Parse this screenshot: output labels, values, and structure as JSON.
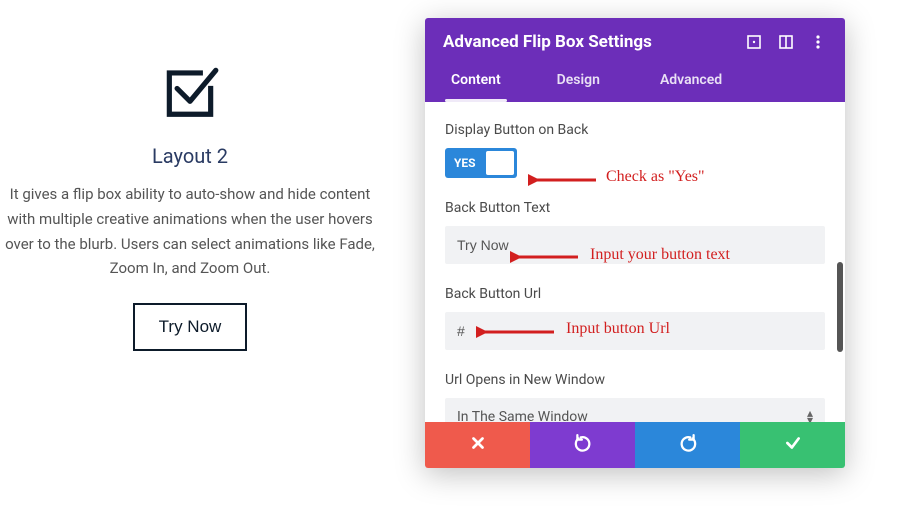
{
  "preview": {
    "title": "Layout 2",
    "desc": "It gives a flip box ability to auto-show and hide content with multiple creative animations when the user hovers over to the blurb. Users can select animations like Fade, Zoom In, and Zoom Out.",
    "button": "Try Now"
  },
  "panel": {
    "title": "Advanced Flip Box Settings",
    "tabs": {
      "content": "Content",
      "design": "Design",
      "advanced": "Advanced"
    },
    "fields": {
      "display_button_label": "Display Button on Back",
      "toggle_yes": "YES",
      "back_text_label": "Back Button Text",
      "back_text_value": "Try Now",
      "back_url_label": "Back Button Url",
      "back_url_value": "#",
      "url_window_label": "Url Opens in New Window",
      "url_window_value": "In The Same Window"
    }
  },
  "annotations": {
    "a1": "Check as \"Yes\"",
    "a2": "Input your button text",
    "a3": "Input button Url"
  },
  "colors": {
    "purple": "#6c2eb9",
    "blue": "#2b87da",
    "red": "#ef5a4c",
    "green": "#38c172",
    "annot": "#d21f1f"
  }
}
